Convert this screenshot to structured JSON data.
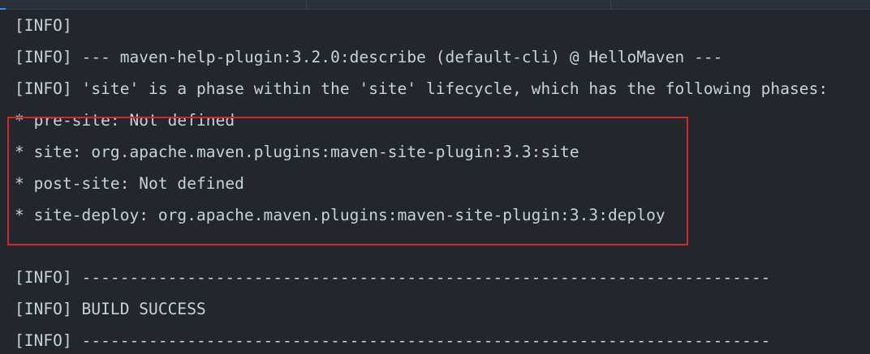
{
  "console": {
    "lines": [
      "[INFO]",
      "[INFO] --- maven-help-plugin:3.2.0:describe (default-cli) @ HelloMaven ---",
      "[INFO] 'site' is a phase within the 'site' lifecycle, which has the following phases:",
      "* pre-site: Not defined",
      "* site: org.apache.maven.plugins:maven-site-plugin:3.3:site",
      "* post-site: Not defined",
      "* site-deploy: org.apache.maven.plugins:maven-site-plugin:3.3:deploy",
      "[INFO] ------------------------------------------------------------------------",
      "[INFO] BUILD SUCCESS",
      "[INFO] ------------------------------------------------------------------------"
    ]
  },
  "colors": {
    "background": "#22272e",
    "text": "#c9d1d9",
    "highlight_border": "#d7262b",
    "active_tab_accent": "#3b8eea"
  }
}
